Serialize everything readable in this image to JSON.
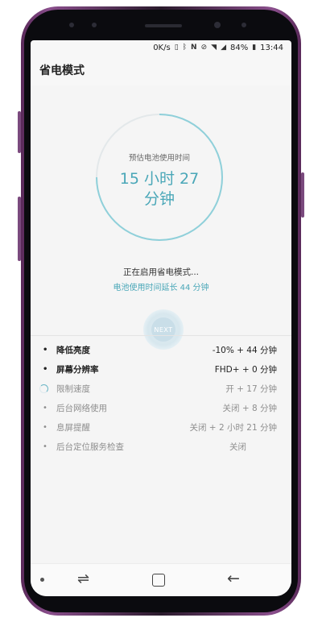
{
  "status_bar": {
    "speed": "0K/s",
    "icons": [
      "vibrate-icon",
      "bluetooth-icon",
      "nfc-icon",
      "no-sim-icon",
      "wifi-icon",
      "signal-icon"
    ],
    "battery": "84%",
    "time": "13:44"
  },
  "header": {
    "title": "省电模式"
  },
  "estimate": {
    "label": "预估电池使用时间",
    "time_line1": "15 小时 27",
    "time_line2": "分钟"
  },
  "progress": {
    "status_text": "正在启用省电模式...",
    "extension_text": "电池使用时间延长 44 分钟"
  },
  "next_button": {
    "label": "NEXT"
  },
  "items": [
    {
      "label": "降低亮度",
      "value": "-10% + 44 分钟",
      "state": "done"
    },
    {
      "label": "屏幕分辨率",
      "value": "FHD+ + 0 分钟",
      "state": "done"
    },
    {
      "label": "限制速度",
      "value": "开 + 17 分钟",
      "state": "in-progress"
    },
    {
      "label": "后台网络使用",
      "value": "关闭 + 8 分钟",
      "state": "pending"
    },
    {
      "label": "息屏提醒",
      "value": "关闭 + 2 小时 21 分钟",
      "state": "pending"
    },
    {
      "label": "后台定位服务检查",
      "value": "关闭",
      "state": "pending"
    }
  ],
  "colors": {
    "accent": "#4aa7b8",
    "phone_frame": "#8a4e8c",
    "text_primary": "#222222",
    "text_disabled": "#8e8e8e"
  }
}
